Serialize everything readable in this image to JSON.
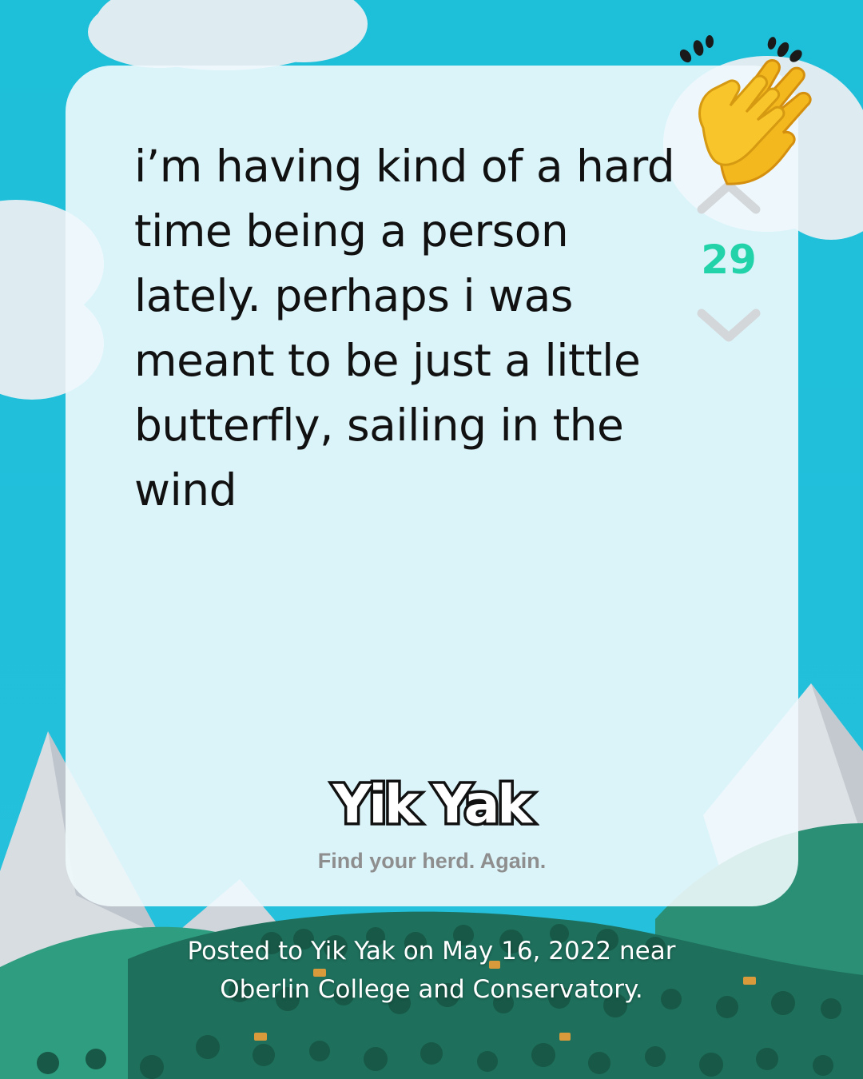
{
  "post": {
    "text": "i’m having kind of a hard time being a person lately. perhaps i was meant to be just a little butterfly, sailing in the wind",
    "vote_count": "29"
  },
  "brand": {
    "logo_text": "Yik Yak",
    "tagline": "Find your herd. Again."
  },
  "caption": {
    "text": "Posted to Yik Yak on May 16, 2022 near Oberlin College and Conservatory."
  },
  "icons": {
    "upvote": "chevron-up-icon",
    "downvote": "chevron-down-icon",
    "reaction": "clapping-hands-icon"
  },
  "colors": {
    "sky": "#22bfdb",
    "vote_count": "#22d2a9",
    "card": "#f0fafd",
    "text": "#111111",
    "tagline": "#8e8e8e",
    "forest": "#1e6f5c"
  }
}
